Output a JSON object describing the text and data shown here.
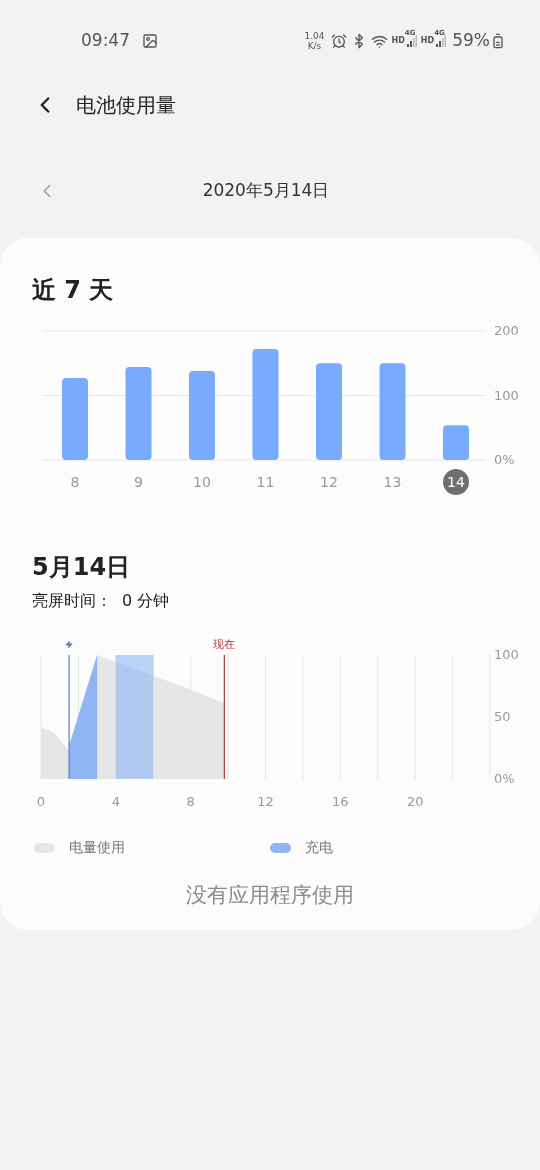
{
  "status_bar": {
    "time": "09:47",
    "speed": [
      "1.04",
      "K/s"
    ],
    "sims": [
      {
        "hd": "HD",
        "net": "4G"
      },
      {
        "hd": "HD",
        "net": "4G"
      }
    ],
    "battery": "59%"
  },
  "header": {
    "title": "电池使用量"
  },
  "date_nav": {
    "date": "2020年5月14日"
  },
  "week": {
    "title": "近 7 天",
    "chart_data": {
      "type": "bar",
      "categories": [
        "8",
        "9",
        "10",
        "11",
        "12",
        "13",
        "14"
      ],
      "values": [
        127,
        144,
        138,
        172,
        150,
        150,
        54
      ],
      "ylim": [
        0,
        200
      ],
      "yticks": [
        {
          "value": 0,
          "label": "0%"
        },
        100,
        200
      ]
    },
    "days": [
      {
        "selected": false
      },
      {
        "selected": false
      },
      {
        "selected": false
      },
      {
        "selected": false
      },
      {
        "selected": false
      },
      {
        "selected": false
      },
      {
        "selected": true
      }
    ]
  },
  "day": {
    "title": "5月14日",
    "screen_time_label": "亮屏时间：",
    "screen_time_value": "0 分钟",
    "chart_data": {
      "type": "area",
      "x": [
        0,
        0.7,
        1.5,
        3,
        7.5,
        9.8
      ],
      "xlim": [
        0,
        24
      ],
      "ylim": [
        0,
        100
      ],
      "xticks": [
        0,
        4,
        8,
        12,
        16,
        20
      ],
      "yticks": [
        {
          "value": 0,
          "label": "0%"
        },
        50,
        100
      ],
      "series": [
        {
          "name": "电量使用",
          "color": "#e6e6e6",
          "values": [
            42,
            37,
            23,
            100,
            75,
            61
          ]
        },
        {
          "name": "充电",
          "color": "#8fb5f5",
          "values": [
            null,
            null,
            27,
            100,
            null,
            null
          ]
        }
      ],
      "grid": true,
      "bands": [
        {
          "axis": "x",
          "from": 4,
          "to": 6,
          "color": "#8fb5f5"
        }
      ],
      "ref_lines": [
        {
          "axis": "x",
          "value": 1.5,
          "color": "#5b7fb8"
        },
        {
          "axis": "x",
          "value": 9.8,
          "label": "现在",
          "color": "#aa3333"
        }
      ]
    }
  },
  "empty_message": "没有应用程序使用"
}
